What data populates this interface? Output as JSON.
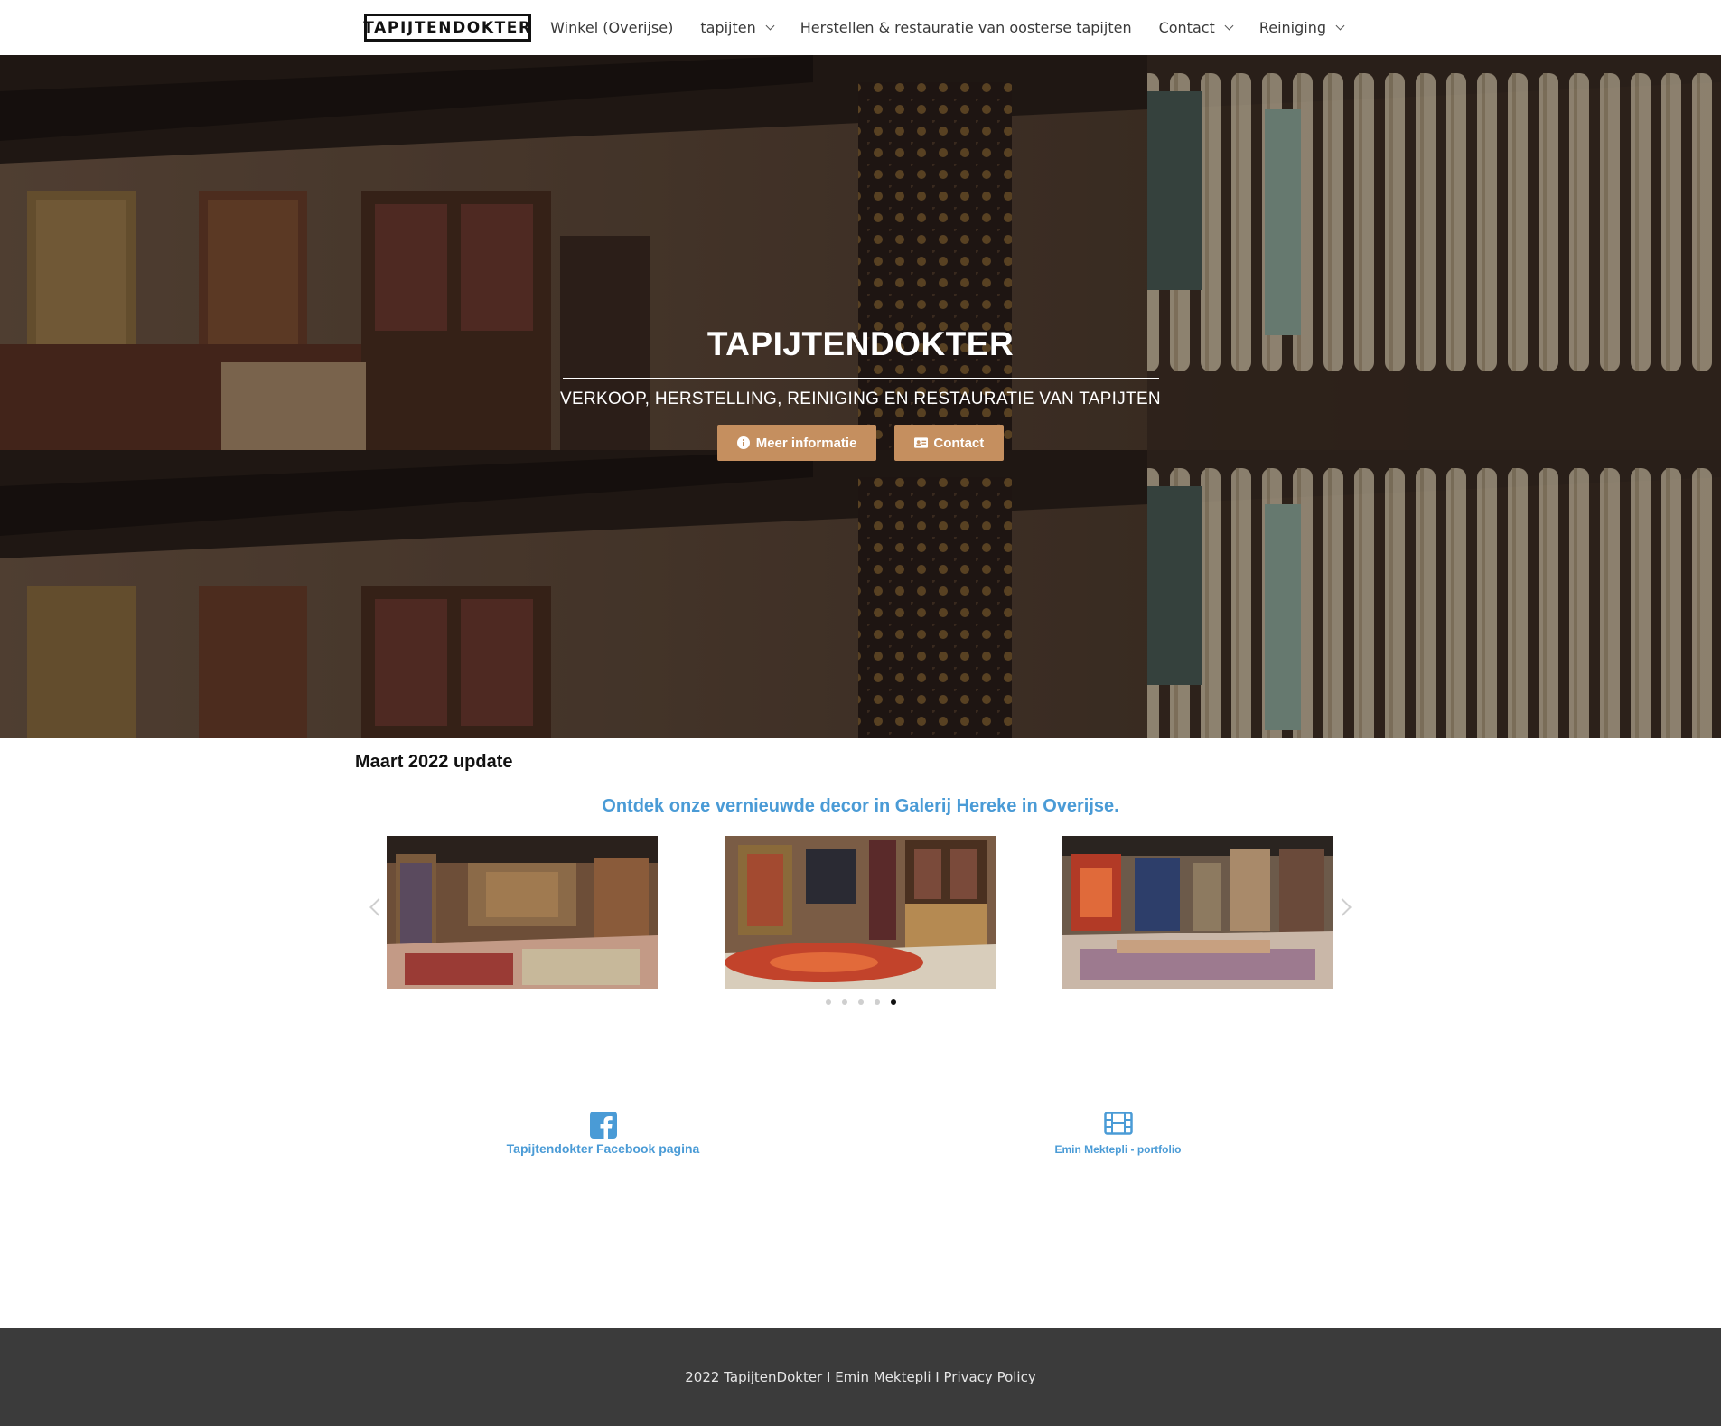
{
  "header": {
    "logo_text": "TAPIJTENDOKTER",
    "nav": [
      {
        "label": "Winkel (Overijse)",
        "dropdown": false
      },
      {
        "label": "tapijten",
        "dropdown": true
      },
      {
        "label": "Herstellen & restauratie van oosterse tapijten",
        "dropdown": false
      },
      {
        "label": "Contact",
        "dropdown": true
      },
      {
        "label": "Reiniging",
        "dropdown": true
      }
    ]
  },
  "hero": {
    "title": "TAPIJTENDOKTER",
    "subtitle": "VERKOOP, HERSTELLING, REINIGING EN RESTAURATIE VAN TAPIJTEN",
    "buttons": {
      "info_label": "Meer informatie",
      "info_icon": "info-circle-icon",
      "contact_label": "Contact",
      "contact_icon": "id-card-icon"
    },
    "button_color": "#c58f5f"
  },
  "update": {
    "title": "Maart 2022 update",
    "tagline": "Ontdek onze vernieuwde decor in Galerij Hereke in Overijse."
  },
  "carousel": {
    "slide_count": 5,
    "active_slide": 5
  },
  "social": {
    "facebook_label": "Tapijtendokter Facebook pagina",
    "facebook_icon": "facebook-square-icon",
    "portfolio_label": "Emin Mektepli - portfolio",
    "portfolio_icon": "film-icon"
  },
  "footer": {
    "text": "2022 TapijtenDokter I Emin Mektepli I Privacy Policy"
  },
  "colors": {
    "accent_blue": "#4a9bd6",
    "footer_bg": "#3b3b3b"
  }
}
